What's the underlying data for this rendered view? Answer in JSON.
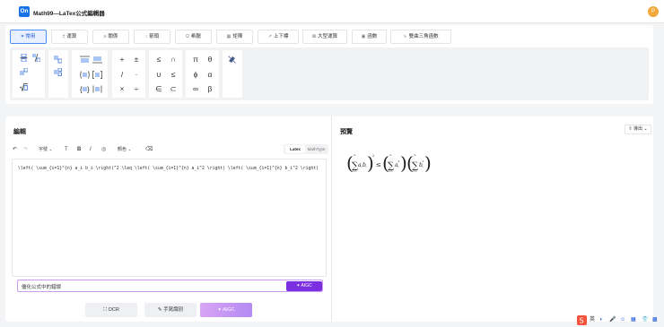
{
  "app": {
    "logo_text": "On",
    "title": "Math99—LaTex公式編輯器",
    "avatar_letter": "P"
  },
  "tabs": [
    {
      "label": "常用",
      "icon": "hash-icon",
      "active": true
    },
    {
      "label": "運算",
      "icon": "plus-minus-icon"
    },
    {
      "label": "關係",
      "icon": "relation-icon"
    },
    {
      "label": "箭頭",
      "icon": "arrows-icon"
    },
    {
      "label": "希臘",
      "icon": "omega-icon"
    },
    {
      "label": "矩陣",
      "icon": "matrix-icon"
    },
    {
      "label": "上下標",
      "icon": "subscript-icon"
    },
    {
      "label": "大型運算",
      "icon": "big-operator-icon"
    },
    {
      "label": "函數",
      "icon": "function-icon"
    },
    {
      "label": "雙曲三角函數",
      "icon": "hyperbolic-icon"
    }
  ],
  "symbols": {
    "ops": [
      "+",
      "±",
      "/",
      "·",
      "×",
      "÷"
    ],
    "rel": [
      "≤",
      "∩",
      "∪",
      "≤",
      "∈",
      "⊂"
    ],
    "greek": [
      "π",
      "θ",
      "ϕ",
      "α",
      "∞",
      "β"
    ]
  },
  "editor": {
    "title": "編輯",
    "toolbar": {
      "font_label": "字號",
      "color_label": "顏色",
      "mode_latex": "Latex",
      "mode_mathtype": "MathType"
    },
    "code": "\\left( \\sum_{i=1}^{n} a_i b_i \\right)^2 \\leq \\left( \\sum_{i=1}^{n} a_i^2 \\right) \\left( \\sum_{i=1}^{n} b_i^2 \\right)",
    "ai_input_value": "優化公式中的錯誤",
    "ai_button": "AIGC",
    "ocr_button": "OCR",
    "handwriting_button": "手寫識別",
    "aigc_button": "AIGC"
  },
  "preview": {
    "title": "預覽",
    "export_label": "導出",
    "formula": {
      "sum_top": "n",
      "sum_bottom": "i=1",
      "term1": "a",
      "term1_sub1": "i",
      "term1b": "b",
      "term1_sub2": "i",
      "outer_sup": "2",
      "relation": "≤",
      "term2": "a",
      "term2_sub": "i",
      "term2_sup": "2",
      "term3": "b",
      "term3_sub": "i",
      "term3_sup": "2"
    }
  },
  "tray": {
    "ime": "英"
  },
  "colors": {
    "accent": "#1a73e8",
    "ai_purple": "#7c2fe0",
    "tab_active_bg": "#e8f0fe"
  }
}
